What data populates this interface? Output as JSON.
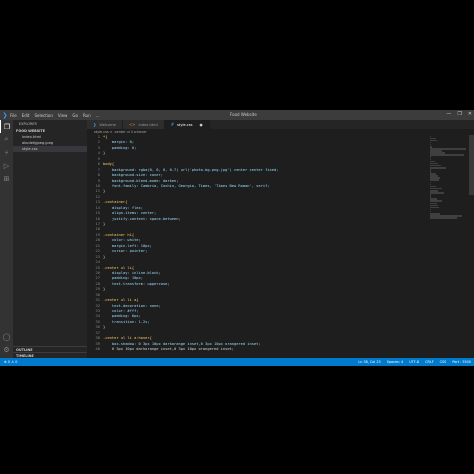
{
  "titlebar": {
    "menu": [
      "File",
      "Edit",
      "Selection",
      "View",
      "Go",
      "Run",
      "..."
    ],
    "title": "Food Website",
    "controls": [
      "—",
      "❐",
      "✕"
    ]
  },
  "sidebar": {
    "header": "EXPLORER",
    "section": "FOOD WEBSITE",
    "files": [
      {
        "name": "index.html",
        "active": false
      },
      {
        "name": "abcdefgjpeg.jpeg",
        "active": false
      },
      {
        "name": "style.css",
        "active": true
      }
    ],
    "outline": "OUTLINE",
    "timeline": "TIMELINE"
  },
  "tabs": [
    {
      "label": "Welcome",
      "active": false
    },
    {
      "label": "index.html",
      "active": false
    },
    {
      "label": "style.css",
      "active": true
    }
  ],
  "breadcrumb": "style.css  >  .center ul li a:hover",
  "code_lines": [
    {
      "n": "1",
      "text": "*{"
    },
    {
      "n": "2",
      "text": "    margin: 0;"
    },
    {
      "n": "3",
      "text": "    padding: 0;"
    },
    {
      "n": "4",
      "text": "}"
    },
    {
      "n": "5",
      "text": ""
    },
    {
      "n": "6",
      "text": "body{"
    },
    {
      "n": "7",
      "text": "    background: rgba(0, 0, 0, 0.7) url('photo.bg.png.jpg') center center fixed;"
    },
    {
      "n": "8",
      "text": "    background-size: cover;"
    },
    {
      "n": "9",
      "text": "    background-blend-mode: darken;"
    },
    {
      "n": "10",
      "text": "    font-family: Cambria, Cochin, Georgia, Times, 'Times New Roman', serif;"
    },
    {
      "n": "11",
      "text": "}"
    },
    {
      "n": "12",
      "text": ""
    },
    {
      "n": "13",
      "text": ".container{"
    },
    {
      "n": "14",
      "text": "    display: flex;"
    },
    {
      "n": "15",
      "text": "    align-items: center;"
    },
    {
      "n": "16",
      "text": "    justify-content: space-between;"
    },
    {
      "n": "17",
      "text": "}"
    },
    {
      "n": "18",
      "text": ""
    },
    {
      "n": "19",
      "text": ".container h1{"
    },
    {
      "n": "20",
      "text": "    color: white;"
    },
    {
      "n": "21",
      "text": "    margin-left: 10px;"
    },
    {
      "n": "22",
      "text": "    cursor: pointer;"
    },
    {
      "n": "23",
      "text": "}"
    },
    {
      "n": "24",
      "text": ""
    },
    {
      "n": "25",
      "text": ".center ul li{"
    },
    {
      "n": "26",
      "text": "    display: inline-block;"
    },
    {
      "n": "27",
      "text": "    padding: 10px;"
    },
    {
      "n": "28",
      "text": "    text-transform: uppercase;"
    },
    {
      "n": "29",
      "text": "}"
    },
    {
      "n": "30",
      "text": ""
    },
    {
      "n": "31",
      "text": ".center ul li a{"
    },
    {
      "n": "32",
      "text": "    text-decoration: none;"
    },
    {
      "n": "33",
      "text": "    color: #fff;"
    },
    {
      "n": "34",
      "text": "    padding: 6px;"
    },
    {
      "n": "35",
      "text": "    transition: 1.2s;"
    },
    {
      "n": "36",
      "text": "}"
    },
    {
      "n": "37",
      "text": ""
    },
    {
      "n": "38",
      "text": ".center ul li a:hover{"
    },
    {
      "n": "39",
      "text": "    box-shadow: 0 3px 10px darkorange inset,0 3px 10px orangered inset;"
    },
    {
      "n": "40",
      "text": "    0 3px 10px darkorange inset,0 3px 10px orangered inset;"
    }
  ],
  "status": {
    "left": [
      "⊗ 0  ⚠ 0"
    ],
    "right": [
      "Ln 38, Col 23",
      "Spaces: 4",
      "UTF-8",
      "CRLF",
      "CSS",
      "Port : 5500"
    ]
  },
  "colors": {
    "editor_bg": "#1e1e1e",
    "status_bg": "#007acc",
    "accent": "#3b9cff"
  }
}
